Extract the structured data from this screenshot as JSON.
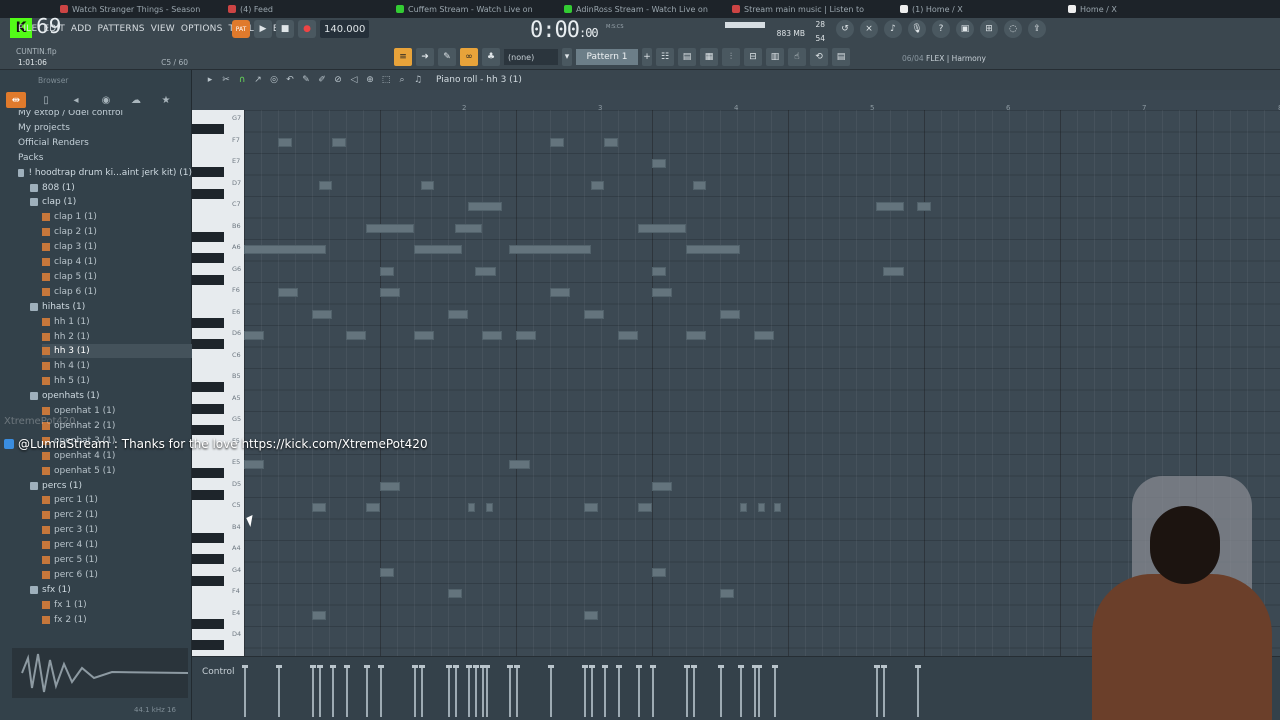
{
  "browser_tabs": [
    {
      "label": "Watch Stranger Things - Season",
      "fav": "r"
    },
    {
      "label": "(4) Feed",
      "fav": "r"
    },
    {
      "label": "Cuffem Stream - Watch Live on",
      "fav": "g"
    },
    {
      "label": "AdinRoss Stream - Watch Live on",
      "fav": "g"
    },
    {
      "label": "Stream main music | Listen to",
      "fav": "r"
    },
    {
      "label": "(1) Home / X",
      "fav": "x"
    },
    {
      "label": "Home / X",
      "fav": "x"
    }
  ],
  "stream": {
    "viewer_count": "69",
    "chat_user": "@LumiaStream",
    "chat_text": ": Thanks for the love https://kick.com/XtremePot420",
    "watermark": "XtremePot420"
  },
  "menu": [
    "FILE",
    "EDIT",
    "ADD",
    "PATTERNS",
    "VIEW",
    "OPTIONS",
    "TOOLS",
    "HELP"
  ],
  "hint": {
    "file": "CUNTIN.flp",
    "position": "1:01:06",
    "channel": "C5 / 60"
  },
  "transport": {
    "mode": "PAT",
    "tempo": "140.000",
    "time_main": "0:00",
    "time_small": ":00",
    "time_unit": "M:S:CS"
  },
  "cpu": {
    "value": "28",
    "memory": "883 MB",
    "voices": "54"
  },
  "toolbar": {
    "snap": "(none)",
    "pattern": "Pattern 1"
  },
  "hint_right": {
    "counter": "06/04",
    "plugin": "FLEX | Harmony"
  },
  "browser": {
    "title": "Browser",
    "tree": [
      {
        "label": "My extop / Odel control",
        "type": "hdr",
        "indent": 0
      },
      {
        "label": "My projects",
        "type": "hdr",
        "indent": 0
      },
      {
        "label": "Official Renders",
        "type": "hdr",
        "indent": 0
      },
      {
        "label": "Packs",
        "type": "hdr",
        "indent": 0
      },
      {
        "label": "! hoodtrap drum ki...aint jerk kit) (1)",
        "type": "folder",
        "indent": 1
      },
      {
        "label": "808 (1)",
        "type": "folder",
        "indent": 2
      },
      {
        "label": "clap (1)",
        "type": "folder",
        "indent": 2
      },
      {
        "label": "clap 1 (1)",
        "type": "file",
        "indent": 3
      },
      {
        "label": "clap 2 (1)",
        "type": "file",
        "indent": 3
      },
      {
        "label": "clap 3 (1)",
        "type": "file",
        "indent": 3
      },
      {
        "label": "clap 4 (1)",
        "type": "file",
        "indent": 3
      },
      {
        "label": "clap 5 (1)",
        "type": "file",
        "indent": 3
      },
      {
        "label": "clap 6 (1)",
        "type": "file",
        "indent": 3
      },
      {
        "label": "hihats (1)",
        "type": "folder",
        "indent": 2
      },
      {
        "label": "hh 1 (1)",
        "type": "file",
        "indent": 3
      },
      {
        "label": "hh 2 (1)",
        "type": "file",
        "indent": 3
      },
      {
        "label": "hh 3 (1)",
        "type": "file sel",
        "indent": 3
      },
      {
        "label": "hh 4 (1)",
        "type": "file",
        "indent": 3
      },
      {
        "label": "hh 5 (1)",
        "type": "file",
        "indent": 3
      },
      {
        "label": "openhats (1)",
        "type": "folder",
        "indent": 2
      },
      {
        "label": "openhat 1 (1)",
        "type": "file",
        "indent": 3
      },
      {
        "label": "openhat 2 (1)",
        "type": "file",
        "indent": 3
      },
      {
        "label": "openhat 3 (1)",
        "type": "file",
        "indent": 3
      },
      {
        "label": "openhat 4 (1)",
        "type": "file",
        "indent": 3
      },
      {
        "label": "openhat 5 (1)",
        "type": "file",
        "indent": 3
      },
      {
        "label": "percs (1)",
        "type": "folder",
        "indent": 2
      },
      {
        "label": "perc 1 (1)",
        "type": "file",
        "indent": 3
      },
      {
        "label": "perc 2 (1)",
        "type": "file",
        "indent": 3
      },
      {
        "label": "perc 3 (1)",
        "type": "file",
        "indent": 3
      },
      {
        "label": "perc 4 (1)",
        "type": "file",
        "indent": 3
      },
      {
        "label": "perc 5 (1)",
        "type": "file",
        "indent": 3
      },
      {
        "label": "perc 6 (1)",
        "type": "file",
        "indent": 3
      },
      {
        "label": "sfx (1)",
        "type": "folder",
        "indent": 2
      },
      {
        "label": "fx 1 (1)",
        "type": "file",
        "indent": 3
      },
      {
        "label": "fx 2 (1)",
        "type": "file",
        "indent": 3
      }
    ],
    "footer_left": "",
    "footer_right": "44.1 kHz 16"
  },
  "pianoroll": {
    "title": "Piano roll - hh 3 (1)",
    "bar_labels": [
      "2",
      "3",
      "4",
      "5",
      "6",
      "7",
      "8"
    ],
    "key_labels": [
      "G7",
      "F7",
      "E7",
      "D7",
      "C7",
      "B6",
      "A6",
      "G6",
      "F6",
      "E6",
      "D6",
      "C6",
      "B5",
      "A5",
      "G5",
      "F5",
      "E5",
      "D5",
      "C5",
      "B4",
      "A4",
      "G4",
      "F4",
      "E4",
      "D4"
    ],
    "notes": [
      {
        "bar": 1.25,
        "len": 0.1,
        "pitch": "F7"
      },
      {
        "bar": 1.65,
        "len": 0.1,
        "pitch": "F7"
      },
      {
        "bar": 3.25,
        "len": 0.1,
        "pitch": "F7"
      },
      {
        "bar": 3.65,
        "len": 0.1,
        "pitch": "F7"
      },
      {
        "bar": 1.55,
        "len": 0.1,
        "pitch": "D7"
      },
      {
        "bar": 2.3,
        "len": 0.1,
        "pitch": "D7"
      },
      {
        "bar": 3.55,
        "len": 0.1,
        "pitch": "D7"
      },
      {
        "bar": 4.3,
        "len": 0.1,
        "pitch": "D7"
      },
      {
        "bar": 4.0,
        "len": 0.1,
        "pitch": "E7"
      },
      {
        "bar": 2.65,
        "len": 0.25,
        "pitch": "C7"
      },
      {
        "bar": 5.65,
        "len": 0.2,
        "pitch": "C7"
      },
      {
        "bar": 5.95,
        "len": 0.1,
        "pitch": "C7"
      },
      {
        "bar": 1.9,
        "len": 0.35,
        "pitch": "B6"
      },
      {
        "bar": 2.55,
        "len": 0.2,
        "pitch": "B6"
      },
      {
        "bar": 3.9,
        "len": 0.35,
        "pitch": "B6"
      },
      {
        "bar": 1.0,
        "len": 0.6,
        "pitch": "A6"
      },
      {
        "bar": 2.25,
        "len": 0.35,
        "pitch": "A6"
      },
      {
        "bar": 2.95,
        "len": 0.6,
        "pitch": "A6"
      },
      {
        "bar": 4.25,
        "len": 0.4,
        "pitch": "A6"
      },
      {
        "bar": 2.0,
        "len": 0.1,
        "pitch": "G6"
      },
      {
        "bar": 4.0,
        "len": 0.1,
        "pitch": "G6"
      },
      {
        "bar": 2.7,
        "len": 0.15,
        "pitch": "G6"
      },
      {
        "bar": 5.7,
        "len": 0.15,
        "pitch": "G6"
      },
      {
        "bar": 1.25,
        "len": 0.15,
        "pitch": "F6"
      },
      {
        "bar": 2.0,
        "len": 0.15,
        "pitch": "F6"
      },
      {
        "bar": 3.25,
        "len": 0.15,
        "pitch": "F6"
      },
      {
        "bar": 4.0,
        "len": 0.15,
        "pitch": "F6"
      },
      {
        "bar": 1.5,
        "len": 0.15,
        "pitch": "E6"
      },
      {
        "bar": 2.5,
        "len": 0.15,
        "pitch": "E6"
      },
      {
        "bar": 3.5,
        "len": 0.15,
        "pitch": "E6"
      },
      {
        "bar": 4.5,
        "len": 0.15,
        "pitch": "E6"
      },
      {
        "bar": 1.0,
        "len": 0.15,
        "pitch": "D6"
      },
      {
        "bar": 1.75,
        "len": 0.15,
        "pitch": "D6"
      },
      {
        "bar": 2.25,
        "len": 0.15,
        "pitch": "D6"
      },
      {
        "bar": 2.75,
        "len": 0.15,
        "pitch": "D6"
      },
      {
        "bar": 3.0,
        "len": 0.15,
        "pitch": "D6"
      },
      {
        "bar": 3.75,
        "len": 0.15,
        "pitch": "D6"
      },
      {
        "bar": 4.25,
        "len": 0.15,
        "pitch": "D6"
      },
      {
        "bar": 4.75,
        "len": 0.15,
        "pitch": "D6"
      },
      {
        "bar": 1.0,
        "len": 0.15,
        "pitch": "E5"
      },
      {
        "bar": 2.95,
        "len": 0.15,
        "pitch": "E5"
      },
      {
        "bar": 2.0,
        "len": 0.15,
        "pitch": "D5"
      },
      {
        "bar": 4.0,
        "len": 0.15,
        "pitch": "D5"
      },
      {
        "bar": 1.5,
        "len": 0.1,
        "pitch": "C5"
      },
      {
        "bar": 1.9,
        "len": 0.1,
        "pitch": "C5"
      },
      {
        "bar": 2.65,
        "len": 0.05,
        "pitch": "C5"
      },
      {
        "bar": 2.78,
        "len": 0.05,
        "pitch": "C5"
      },
      {
        "bar": 3.5,
        "len": 0.1,
        "pitch": "C5"
      },
      {
        "bar": 3.9,
        "len": 0.1,
        "pitch": "C5"
      },
      {
        "bar": 4.65,
        "len": 0.05,
        "pitch": "C5"
      },
      {
        "bar": 4.78,
        "len": 0.05,
        "pitch": "C5"
      },
      {
        "bar": 4.9,
        "len": 0.05,
        "pitch": "C5"
      },
      {
        "bar": 2.0,
        "len": 0.1,
        "pitch": "G4"
      },
      {
        "bar": 4.0,
        "len": 0.1,
        "pitch": "G4"
      },
      {
        "bar": 2.5,
        "len": 0.1,
        "pitch": "F4"
      },
      {
        "bar": 4.5,
        "len": 0.1,
        "pitch": "F4"
      },
      {
        "bar": 1.5,
        "len": 0.1,
        "pitch": "E4"
      },
      {
        "bar": 3.5,
        "len": 0.1,
        "pitch": "E4"
      }
    ],
    "control_label": "Control"
  }
}
